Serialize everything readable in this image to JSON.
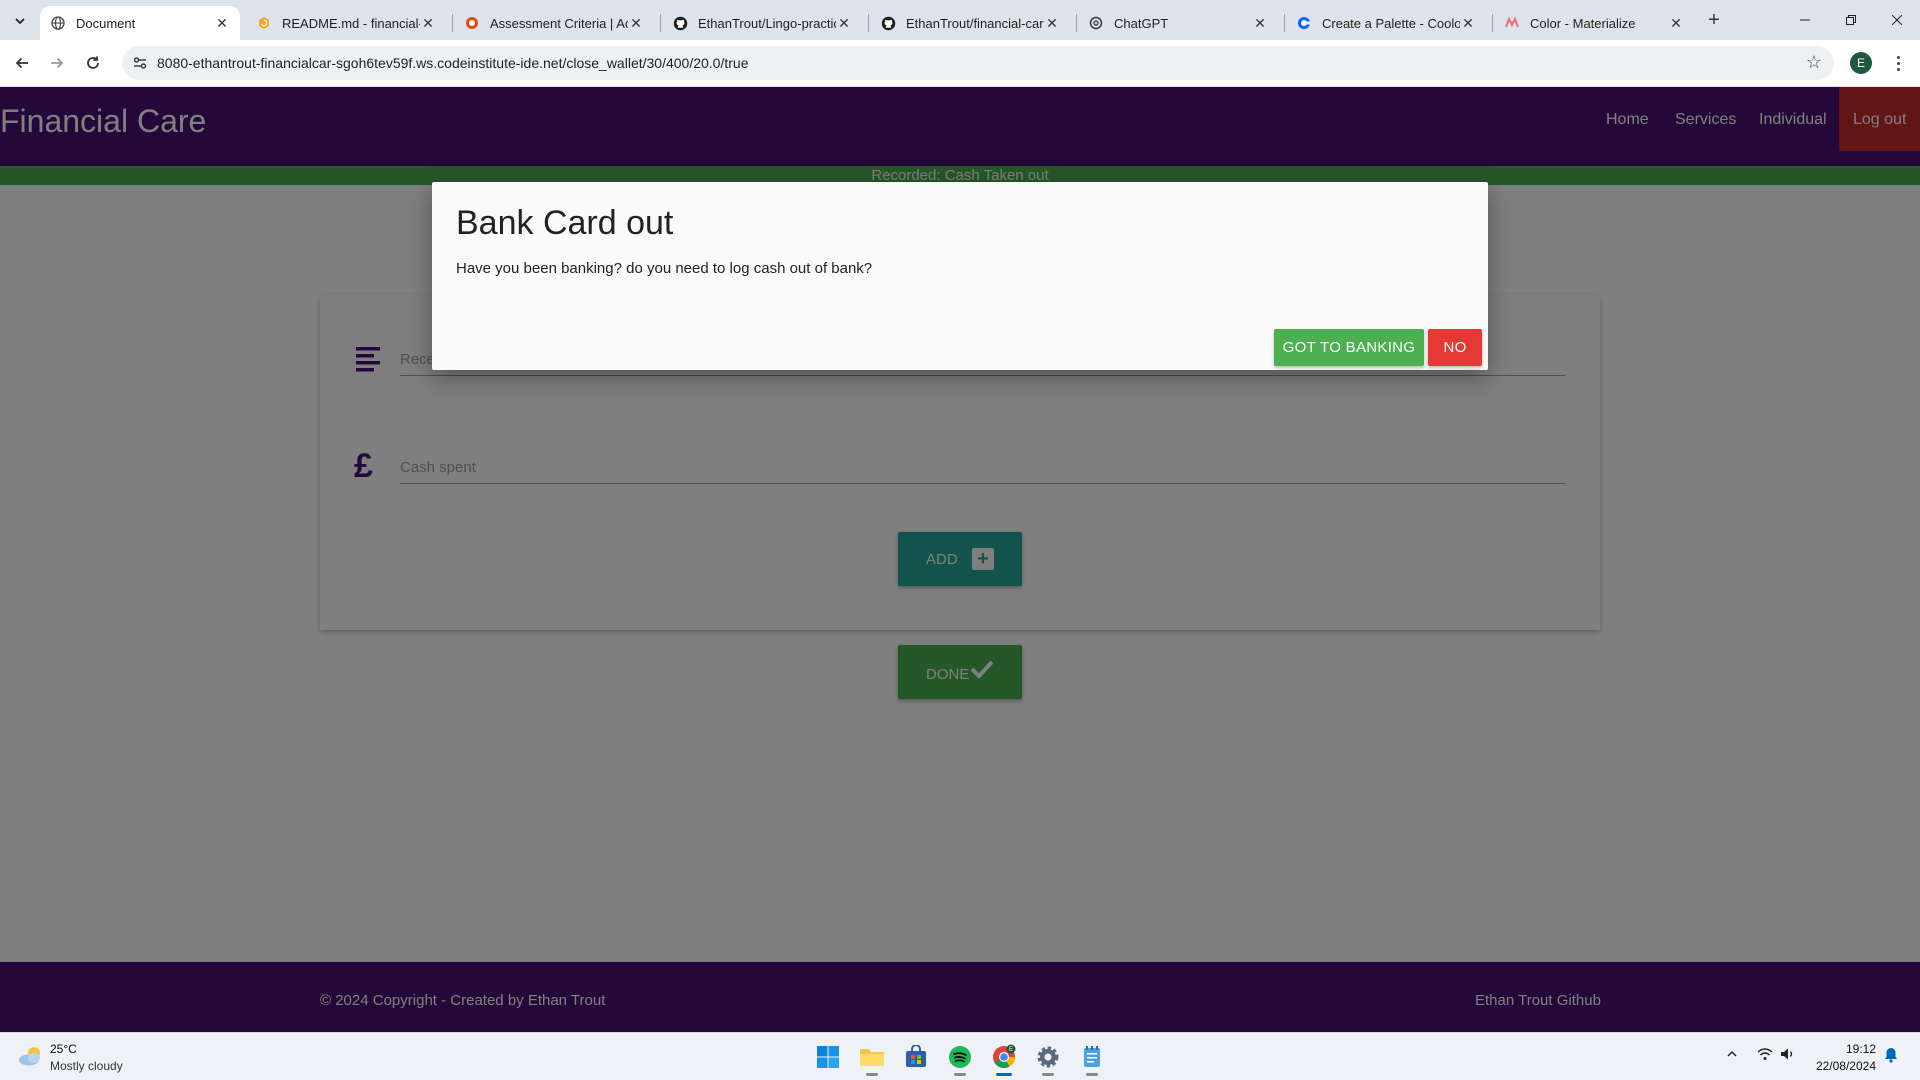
{
  "browser": {
    "tabs": [
      {
        "title": "Document",
        "active": true
      },
      {
        "title": "README.md - financial-ca",
        "active": false
      },
      {
        "title": "Assessment Criteria | Acti",
        "active": false
      },
      {
        "title": "EthanTrout/Lingo-practice",
        "active": false
      },
      {
        "title": "EthanTrout/financial-care",
        "active": false
      },
      {
        "title": "ChatGPT",
        "active": false
      },
      {
        "title": "Create a Palette - Coolors",
        "active": false
      },
      {
        "title": "Color - Materialize",
        "active": false
      }
    ],
    "url": "8080-ethantrout-financialcar-sgoh6tev59f.ws.codeinstitute-ide.net/close_wallet/30/400/20.0/true",
    "profile_initial": "E"
  },
  "site": {
    "brand": "Financial Care",
    "nav": {
      "home": "Home",
      "services": "Services",
      "individual": "Individual",
      "logout": "Log out"
    },
    "flash_message": "Recorded: Cash Taken out",
    "form": {
      "receipt_placeholder": "Rece",
      "cash_placeholder": "Cash spent",
      "add_label": "ADD",
      "done_label": "DONE"
    },
    "footer": {
      "copyright": "© 2024 Copyright - Created by Ethan Trout",
      "github": "Ethan Trout Github"
    }
  },
  "modal": {
    "title": "Bank Card out",
    "message": "Have you been banking? do you need to log cash out of bank?",
    "confirm_label": "GOT TO BANKING",
    "cancel_label": "NO"
  },
  "taskbar": {
    "weather_temp": "25°C",
    "weather_desc": "Mostly cloudy",
    "time": "19:12",
    "date": "22/08/2024"
  },
  "colors": {
    "brand_purple": "#4a1174",
    "success_green": "#4caf50",
    "teal": "#26a69a",
    "danger_red": "#e53935",
    "logout_red": "#c62828"
  }
}
